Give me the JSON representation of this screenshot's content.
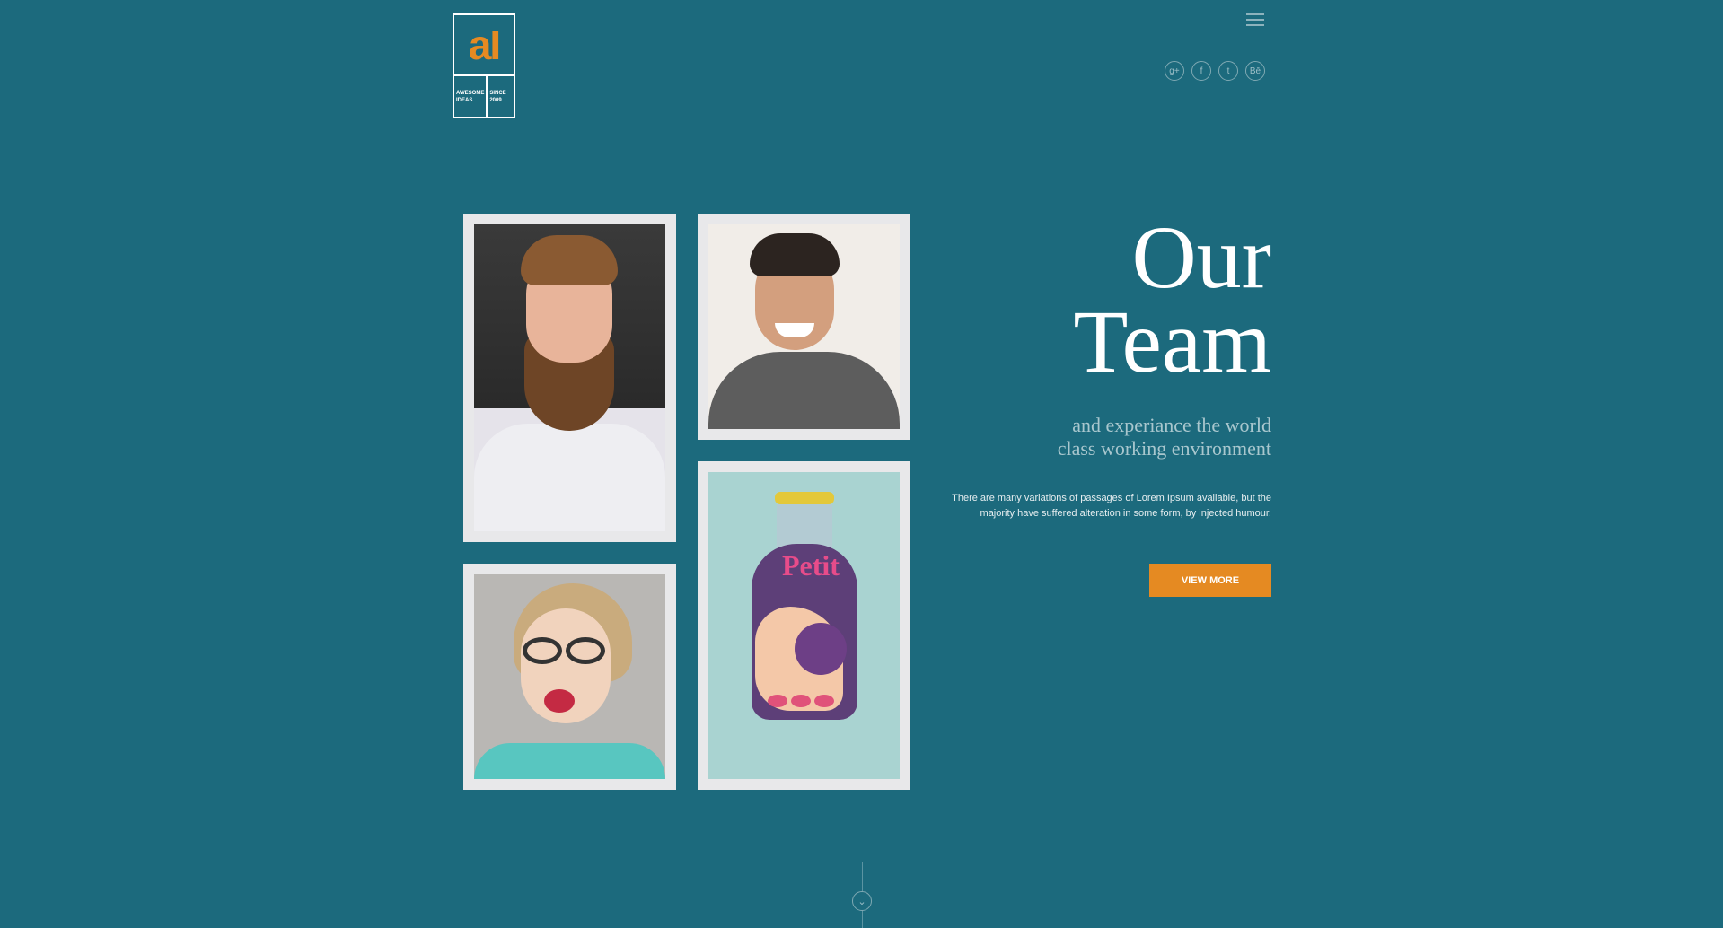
{
  "logo": {
    "mark": "aI",
    "left_text": "AWESOME IDEAS",
    "right_text": "SINCE 2009"
  },
  "social": [
    {
      "label": "g+",
      "icon": "google-plus-icon"
    },
    {
      "label": "f",
      "icon": "facebook-icon"
    },
    {
      "label": "t",
      "icon": "twitter-icon"
    },
    {
      "label": "Bē",
      "icon": "behance-icon"
    }
  ],
  "hero": {
    "title_line1": "Our",
    "title_line2": "Team",
    "subtitle_line1": "and experiance the world",
    "subtitle_line2": "class working environment",
    "description": "There are many variations of passages of Lorem Ipsum available, but the majority have suffered alteration in some form, by injected humour.",
    "button_label": "VIEW MORE"
  },
  "bottle_brand": "Petit",
  "colors": {
    "background": "#1c6a7d",
    "accent": "#e58a22",
    "card": "#e8e8ea"
  }
}
